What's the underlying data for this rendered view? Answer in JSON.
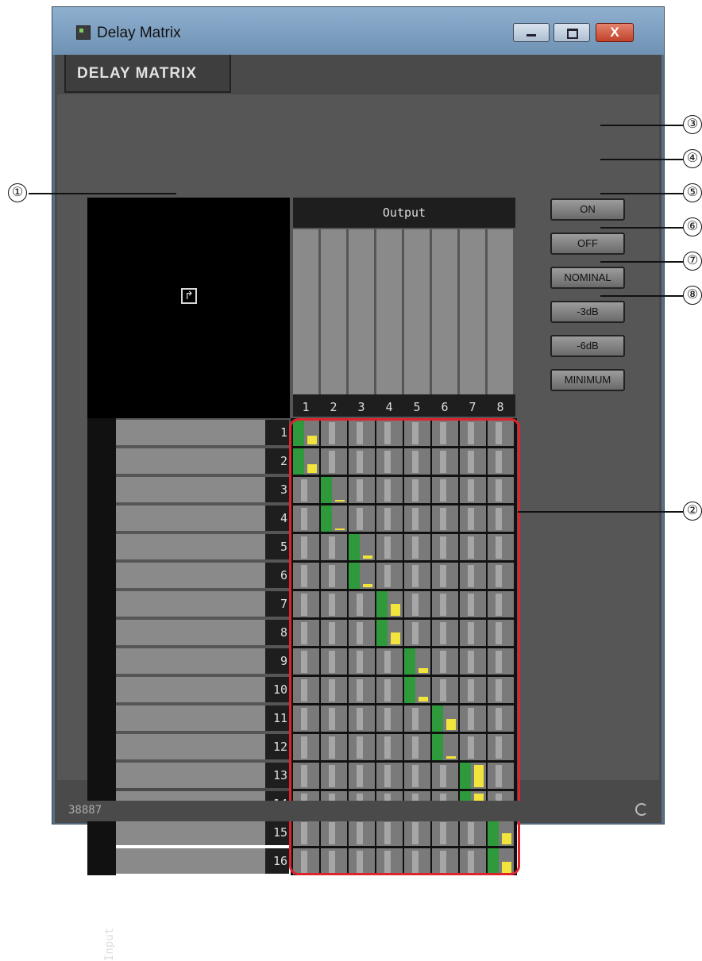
{
  "window": {
    "title": "Delay Matrix",
    "controls": {
      "minimize": "minimize",
      "restore": "restore",
      "close": "X"
    }
  },
  "tab": {
    "label": "DELAY MATRIX"
  },
  "matrix": {
    "output_label": "Output",
    "input_label": "Input",
    "outputs": [
      "1",
      "2",
      "3",
      "4",
      "5",
      "6",
      "7",
      "8"
    ],
    "inputs": [
      "1",
      "2",
      "3",
      "4",
      "5",
      "6",
      "7",
      "8",
      "9",
      "10",
      "11",
      "12",
      "13",
      "14",
      "15",
      "16"
    ],
    "active_routes": [
      {
        "input": 1,
        "output": 1,
        "level": 0.4
      },
      {
        "input": 2,
        "output": 1,
        "level": 0.4
      },
      {
        "input": 3,
        "output": 2,
        "level": 0.05
      },
      {
        "input": 4,
        "output": 2,
        "level": 0.05
      },
      {
        "input": 5,
        "output": 3,
        "level": 0.15
      },
      {
        "input": 6,
        "output": 3,
        "level": 0.15
      },
      {
        "input": 7,
        "output": 4,
        "level": 0.55
      },
      {
        "input": 8,
        "output": 4,
        "level": 0.55
      },
      {
        "input": 9,
        "output": 5,
        "level": 0.2
      },
      {
        "input": 10,
        "output": 5,
        "level": 0.2
      },
      {
        "input": 11,
        "output": 6,
        "level": 0.5
      },
      {
        "input": 12,
        "output": 6,
        "level": 0.1
      },
      {
        "input": 13,
        "output": 7,
        "level": 1.0
      },
      {
        "input": 14,
        "output": 7,
        "level": 1.0
      },
      {
        "input": 15,
        "output": 8,
        "level": 0.5
      },
      {
        "input": 16,
        "output": 8,
        "level": 0.5
      }
    ],
    "colors": {
      "on": "#2e9a3c",
      "level": "#f1e43c",
      "outline": "#e0222c"
    }
  },
  "buttons": {
    "on": "ON",
    "off": "OFF",
    "nominal": "NOMINAL",
    "minus3": "-3dB",
    "minus6": "-6dB",
    "minimum": "MINIMUM"
  },
  "status": {
    "text": "38887"
  },
  "callouts": [
    "①",
    "②",
    "③",
    "④",
    "⑤",
    "⑥",
    "⑦",
    "⑧"
  ],
  "icons": {
    "corner": "arrow-corner-icon",
    "refresh": "refresh-icon",
    "app": "app-icon"
  }
}
